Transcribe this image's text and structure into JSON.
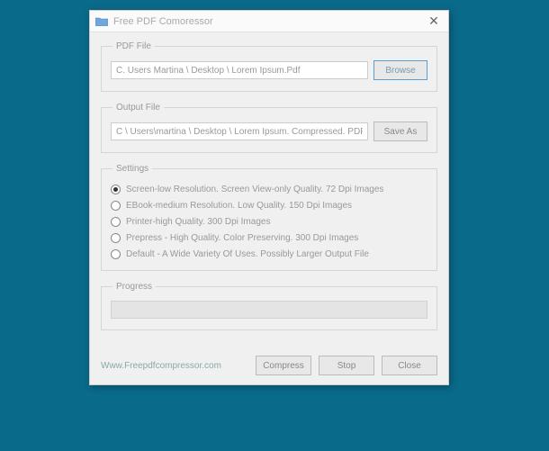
{
  "window": {
    "title": "Free PDF Comoressor"
  },
  "pdfFile": {
    "legend": "PDF File",
    "value": "C. Users Martina \\ Desktop \\ Lorem Ipsum.Pdf",
    "browse": "Browse"
  },
  "outputFile": {
    "legend": "Output File",
    "value": "C \\ Users\\martina \\ Desktop \\ Lorem Ipsum. Compressed. PDF",
    "saveAs": "Save As"
  },
  "settings": {
    "legend": "Settings",
    "options": [
      "Screen-low Resolution. Screen View-only Quality. 72 Dpi Images",
      "EBook-medium Resolution. Low Quality. 150 Dpi Images",
      "Printer-high Quality. 300 Dpi Images",
      "Prepress - High Quality. Color Preserving. 300 Dpi Images",
      "Default - A Wide Variety Of Uses. Possibly Larger Output File"
    ],
    "selectedIndex": 0
  },
  "progress": {
    "legend": "Progress"
  },
  "footer": {
    "link": "Www.Freepdfcompressor.com",
    "compress": "Compress",
    "stop": "Stop",
    "close": "Close"
  }
}
